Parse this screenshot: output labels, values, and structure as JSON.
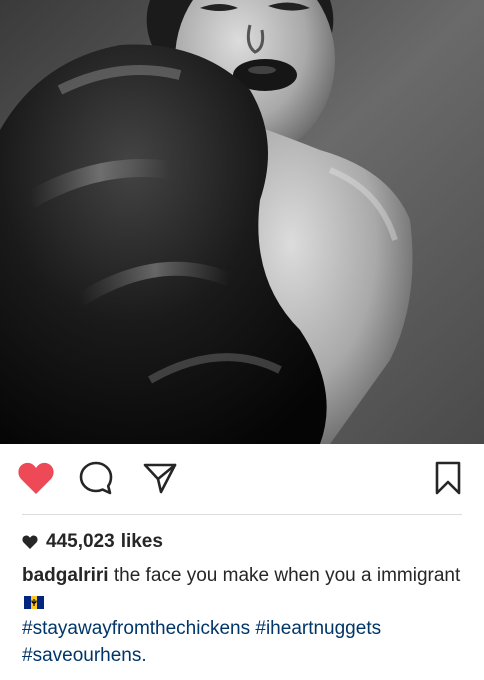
{
  "post": {
    "image": {
      "subject": "black-and-white portrait photo",
      "tone": "monochrome"
    },
    "actions": {
      "like_icon": "heart-filled-icon",
      "like_color": "#ed4956",
      "comment_icon": "speech-bubble-icon",
      "share_icon": "paper-plane-icon",
      "save_icon": "bookmark-icon"
    },
    "likes": {
      "count": "445,023",
      "label": "likes"
    },
    "caption": {
      "username": "badgalriri",
      "text": "the face you make when you a immigrant",
      "flag_icon": "barbados-flag-icon",
      "hashtags": [
        "#stayawayfromthechickens",
        "#iheartnuggets",
        "#saveourhens."
      ]
    },
    "colors": {
      "hashtag": "#003569",
      "text": "#262626",
      "divider": "#dbdbdb"
    }
  }
}
